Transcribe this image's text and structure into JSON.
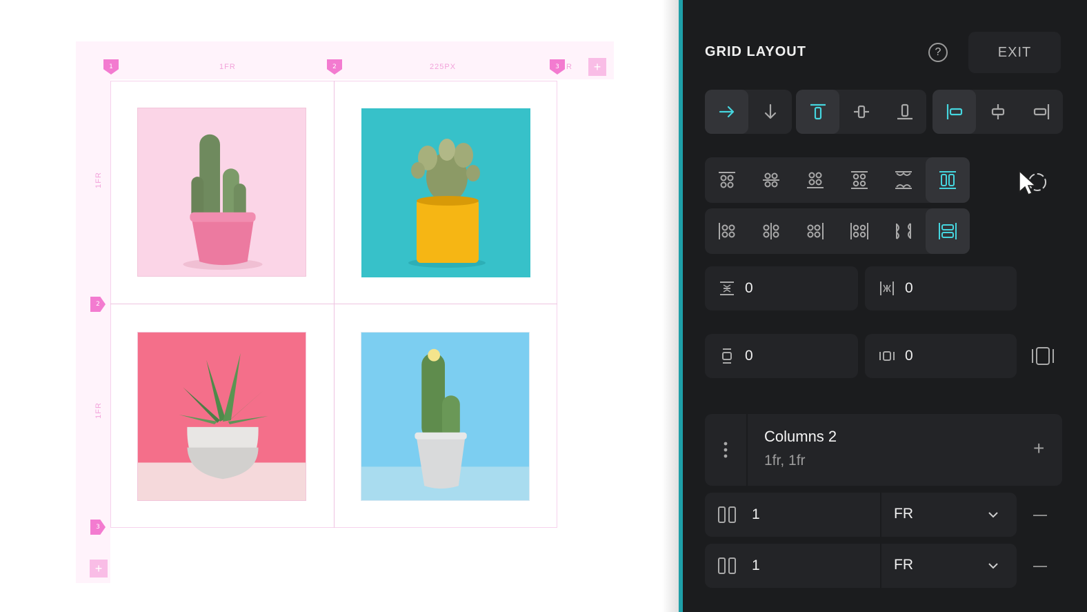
{
  "canvas": {
    "column_markers": [
      "1",
      "2",
      "3"
    ],
    "row_markers": [
      "1",
      "2",
      "3"
    ],
    "column_tracks": [
      "1FR",
      "225PX",
      "R"
    ],
    "row_tracks": [
      "1FR",
      "1FR"
    ],
    "add_column": "+",
    "add_row": "+",
    "photos": [
      {
        "name": "cactus-pink-pot",
        "background": "#fbd3e6"
      },
      {
        "name": "cactus-yellow-pot",
        "background": "#35c0c8"
      },
      {
        "name": "aloe-white-pot",
        "background": "#f56f8b"
      },
      {
        "name": "cactus-grey-pot",
        "background": "#7dcdf0"
      }
    ]
  },
  "panel": {
    "title": "GRID LAYOUT",
    "help_icon": "?",
    "exit_label": "EXIT",
    "accent_color": "#3fd5dd",
    "direction_buttons": [
      {
        "icon": "arrow-right-icon",
        "selected": true
      },
      {
        "icon": "arrow-down-icon",
        "selected": false
      }
    ],
    "align_v_buttons": [
      {
        "icon": "align-top-icon",
        "selected": true
      },
      {
        "icon": "align-middle-icon",
        "selected": false
      },
      {
        "icon": "align-bottom-icon",
        "selected": false
      }
    ],
    "align_h_buttons": [
      {
        "icon": "align-left-icon",
        "selected": true
      },
      {
        "icon": "align-center-icon",
        "selected": false
      },
      {
        "icon": "align-right-icon",
        "selected": false
      }
    ],
    "justify_row_1": [
      {
        "icon": "grid-top-icon",
        "selected": false
      },
      {
        "icon": "grid-center-icon",
        "selected": false
      },
      {
        "icon": "grid-bottom-icon",
        "selected": false
      },
      {
        "icon": "grid-space-between-icon",
        "selected": false
      },
      {
        "icon": "grid-space-around-icon",
        "selected": false
      },
      {
        "icon": "grid-stretch-vertical-icon",
        "selected": true
      }
    ],
    "justify_row_2": [
      {
        "icon": "grid-left-icon",
        "selected": false
      },
      {
        "icon": "grid-h-center-icon",
        "selected": false
      },
      {
        "icon": "grid-right-icon",
        "selected": false
      },
      {
        "icon": "grid-h-space-between-icon",
        "selected": false
      },
      {
        "icon": "grid-h-space-around-icon",
        "selected": false
      },
      {
        "icon": "grid-stretch-horizontal-icon",
        "selected": true
      }
    ],
    "row_gap": "0",
    "column_gap": "0",
    "padding_vertical": "0",
    "padding_horizontal": "0",
    "columns": {
      "title": "Columns 2",
      "summary": "1fr, 1fr",
      "add": "+",
      "items": [
        {
          "value": "1",
          "unit": "FR"
        },
        {
          "value": "1",
          "unit": "FR"
        }
      ]
    }
  }
}
